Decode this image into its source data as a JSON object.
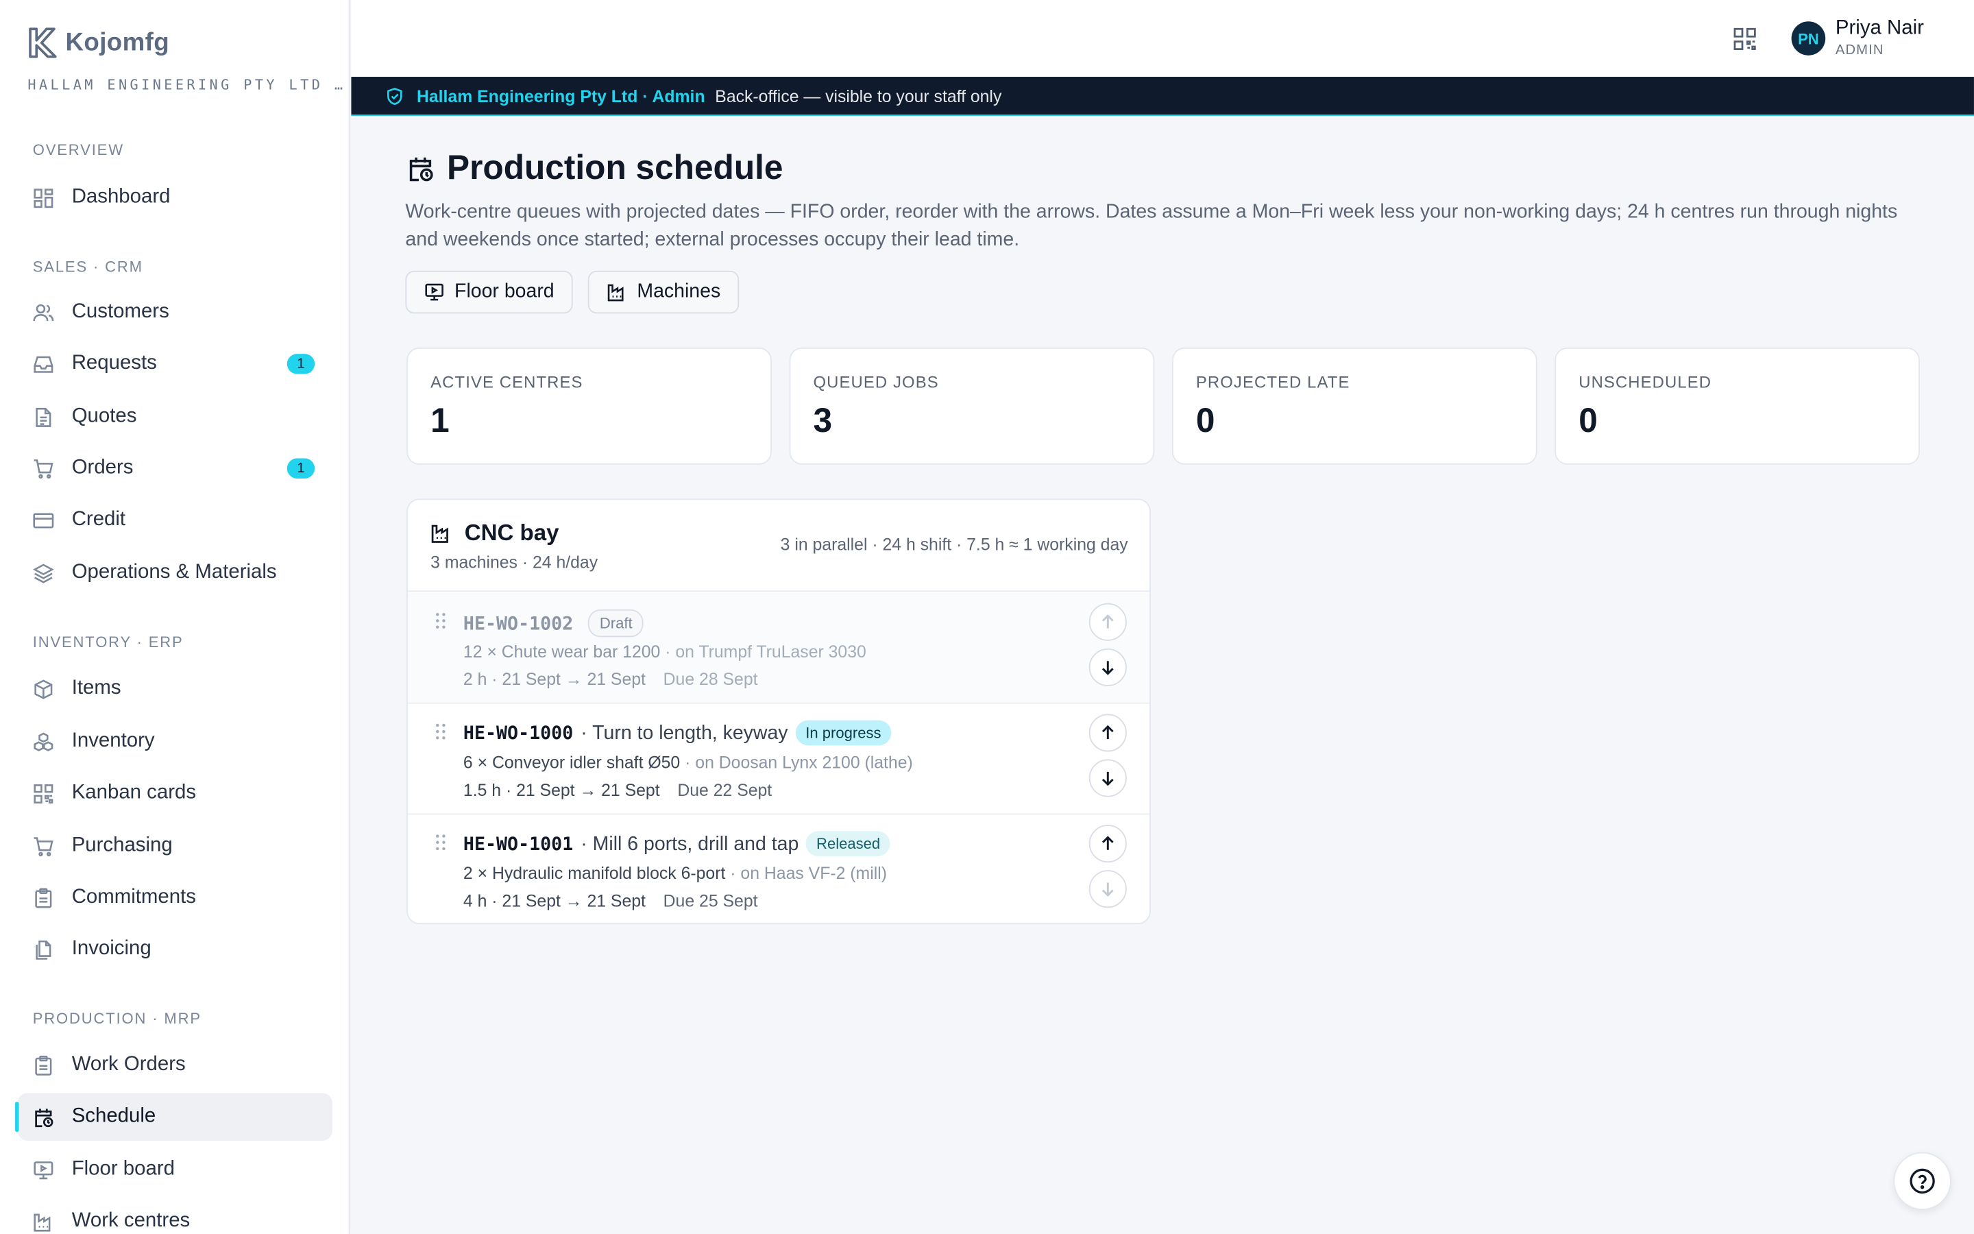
{
  "brand": {
    "name": "Kojomfg",
    "org": "HALLAM ENGINEERING PTY LTD …"
  },
  "sidebar": {
    "sections": {
      "overview": "OVERVIEW",
      "sales": "SALES · CRM",
      "inventory": "INVENTORY · ERP",
      "production": "PRODUCTION · MRP"
    },
    "items": {
      "dashboard": "Dashboard",
      "customers": "Customers",
      "requests": "Requests",
      "requests_badge": "1",
      "quotes": "Quotes",
      "orders": "Orders",
      "orders_badge": "1",
      "credit": "Credit",
      "operations": "Operations & Materials",
      "items": "Items",
      "inventory": "Inventory",
      "kanban": "Kanban cards",
      "purchasing": "Purchasing",
      "commitments": "Commitments",
      "invoicing": "Invoicing",
      "work_orders": "Work Orders",
      "schedule": "Schedule",
      "floor_board": "Floor board",
      "work_centres": "Work centres"
    }
  },
  "user": {
    "initials": "PN",
    "name": "Priya Nair",
    "role": "ADMIN"
  },
  "banner": {
    "strong": "Hallam Engineering Pty Ltd · Admin",
    "text": "Back-office — visible to your staff only"
  },
  "page": {
    "title": "Production schedule",
    "description": "Work-centre queues with projected dates — FIFO order, reorder with the arrows. Dates assume a Mon–Fri week less your non-working days; 24 h centres run through nights and weekends once started; external processes occupy their lead time.",
    "buttons": {
      "floor_board": "Floor board",
      "machines": "Machines"
    }
  },
  "stats": [
    {
      "label": "ACTIVE CENTRES",
      "value": "1"
    },
    {
      "label": "QUEUED JOBS",
      "value": "3"
    },
    {
      "label": "PROJECTED LATE",
      "value": "0"
    },
    {
      "label": "UNSCHEDULED",
      "value": "0"
    }
  ],
  "centre": {
    "name": "CNC bay",
    "sub": "3 machines · 24 h/day",
    "meta": "3 in parallel · 24 h shift · 7.5 h ≈ 1 working day",
    "jobs": [
      {
        "code": "HE-WO-1002",
        "op": "",
        "status": "Draft",
        "qty_item": "12 × Chute wear bar 1200",
        "machine": "· on Trumpf TruLaser 3030",
        "timing": "2 h · 21 Sept → 21 Sept",
        "due": "Due 28 Sept"
      },
      {
        "code": "HE-WO-1000",
        "op": "· Turn to length, keyway",
        "status": "In progress",
        "qty_item": "6 × Conveyor idler shaft Ø50",
        "machine": "· on Doosan Lynx 2100 (lathe)",
        "timing": "1.5 h · 21 Sept → 21 Sept",
        "due": "Due 22 Sept"
      },
      {
        "code": "HE-WO-1001",
        "op": "· Mill 6 ports, drill and tap",
        "status": "Released",
        "qty_item": "2 × Hydraulic manifold block 6-port",
        "machine": "· on Haas VF-2 (mill)",
        "timing": "4 h · 21 Sept → 21 Sept",
        "due": "Due 25 Sept"
      }
    ]
  },
  "colors": {
    "accent": "#22d3ee",
    "banner_bg": "#0f1b2d",
    "avatar_bg": "#0f2a40"
  }
}
